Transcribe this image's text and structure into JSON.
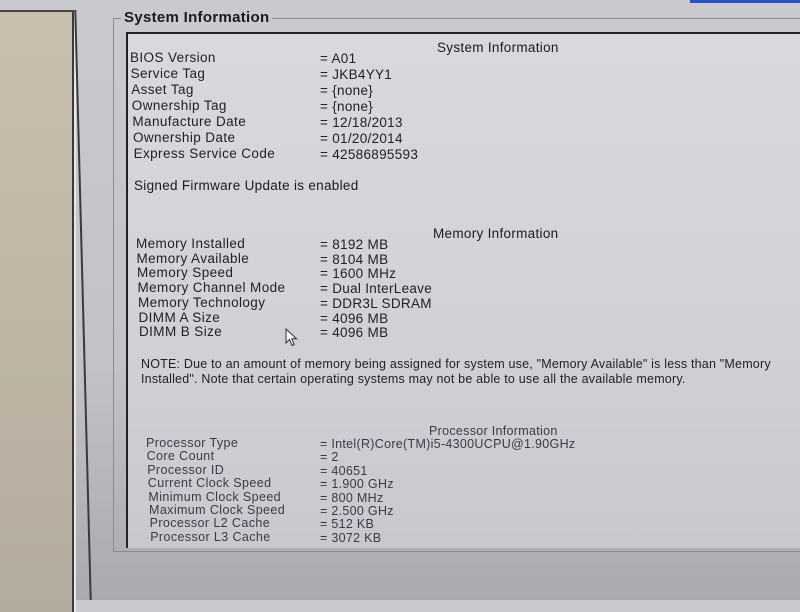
{
  "groupbox_title": "System Information",
  "system": {
    "title": "System Information",
    "rows": [
      {
        "label": "BIOS Version",
        "value": "= A01"
      },
      {
        "label": "Service Tag",
        "value": "= JKB4YY1"
      },
      {
        "label": "Asset Tag",
        "value": "= {none}"
      },
      {
        "label": "Ownership Tag",
        "value": "= {none}"
      },
      {
        "label": "Manufacture Date",
        "value": "= 12/18/2013"
      },
      {
        "label": "Ownership Date",
        "value": "= 01/20/2014"
      },
      {
        "label": "Express Service Code",
        "value": "= 42586895593"
      }
    ],
    "firmware_status": "Signed Firmware Update is enabled"
  },
  "memory": {
    "title": "Memory Information",
    "rows": [
      {
        "label": "Memory Installed",
        "value": "= 8192 MB"
      },
      {
        "label": "Memory Available",
        "value": "= 8104 MB"
      },
      {
        "label": "Memory Speed",
        "value": "= 1600 MHz"
      },
      {
        "label": "Memory Channel Mode",
        "value": "= Dual InterLeave"
      },
      {
        "label": "Memory Technology",
        "value": "= DDR3L SDRAM"
      },
      {
        "label": "DIMM A Size",
        "value": "= 4096 MB"
      },
      {
        "label": "DIMM B Size",
        "value": "= 4096 MB"
      }
    ],
    "note": "NOTE: Due to an amount of memory being assigned for system use, \"Memory Available\" is less than \"Memory Installed\". Note that certain operating systems may not be able to use all the available memory."
  },
  "processor": {
    "title": "Processor Information",
    "rows": [
      {
        "label": "Processor Type",
        "value": "= Intel(R)Core(TM)i5-4300UCPU@1.90GHz"
      },
      {
        "label": "Core Count",
        "value": "= 2"
      },
      {
        "label": "Processor ID",
        "value": "= 40651"
      },
      {
        "label": "Current Clock Speed",
        "value": "= 1.900 GHz"
      },
      {
        "label": "Minimum Clock Speed",
        "value": "= 800 MHz"
      },
      {
        "label": "Maximum Clock Speed",
        "value": "= 2.500 GHz"
      },
      {
        "label": "Processor L2 Cache",
        "value": "= 512 KB"
      },
      {
        "label": "Processor L3 Cache",
        "value": "= 3072 KB"
      }
    ]
  },
  "cursor_icon": "mouse-pointer-icon"
}
